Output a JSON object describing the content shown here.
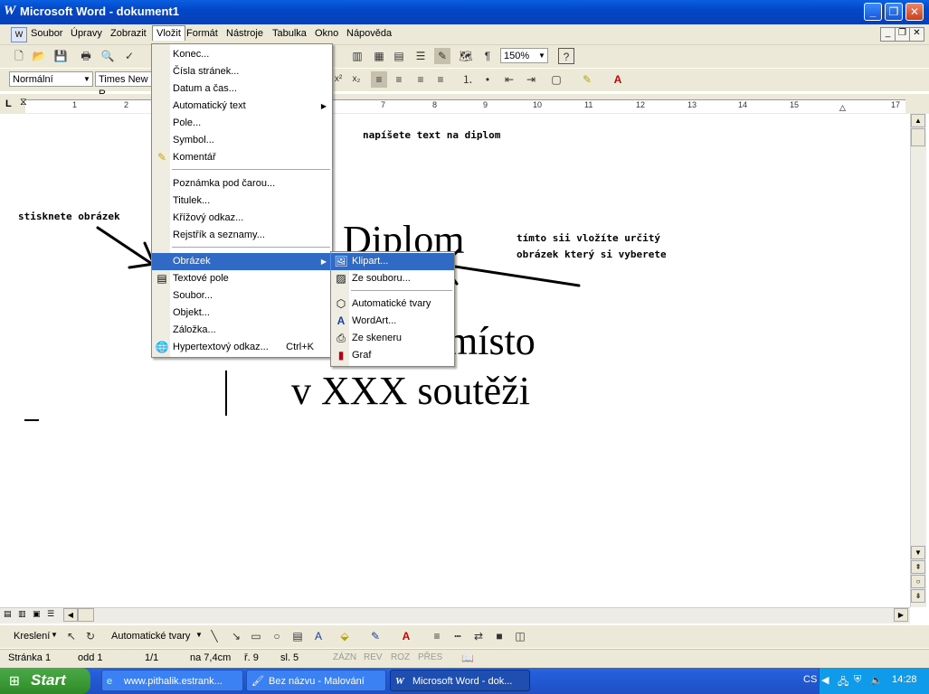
{
  "window": {
    "title": "Microsoft Word - dokument1"
  },
  "menubar": {
    "items": [
      "Soubor",
      "Úpravy",
      "Zobrazit",
      "Vložit",
      "Formát",
      "Nástroje",
      "Tabulka",
      "Okno",
      "Nápověda"
    ]
  },
  "format_toolbar": {
    "style": "Normální",
    "font": "Times New R",
    "zoom": "150%"
  },
  "ruler": {
    "numbers": [
      "1",
      "2",
      "7",
      "8",
      "9",
      "10",
      "11",
      "12",
      "13",
      "14",
      "15",
      "17"
    ]
  },
  "insert_menu": {
    "items": [
      "Konec...",
      "Čísla stránek...",
      "Datum a čas...",
      "Automatický text",
      "Pole...",
      "Symbol...",
      "Komentář",
      "Poznámka pod čarou...",
      "Titulek...",
      "Křížový odkaz...",
      "Rejstřík a seznamy...",
      "Obrázek",
      "Textové pole",
      "Soubor...",
      "Objekt...",
      "Záložka...",
      "Hypertextový odkaz..."
    ],
    "shortcut_hyperlink": "Ctrl+K"
  },
  "picture_submenu": {
    "items": [
      "Klipart...",
      "Ze souboru...",
      "Automatické tvary",
      "WordArt...",
      "Ze skeneru",
      "Graf"
    ]
  },
  "document": {
    "note_top": "napíšete text na diplom",
    "note_left": "stisknete obrázek",
    "note_right_1": "tímto sii vložíte určitý",
    "note_right_2": "obrázek který si vyberete",
    "heading": "Diplom",
    "line2": "místo",
    "line3": "v XXX soutěži"
  },
  "drawing_toolbar": {
    "draw_label": "Kreslení",
    "autoshapes_label": "Automatické tvary"
  },
  "statusbar": {
    "page": "Stránka 1",
    "section": "odd 1",
    "pages": "1/1",
    "position": "na 7,4cm",
    "line": "ř. 9",
    "col": "sl. 5",
    "rec": "ZÁZN",
    "trk": "REV",
    "ext": "ROZ",
    "ovr": "PŘES"
  },
  "taskbar": {
    "start": "Start",
    "tasks": [
      "www.pithalik.estrank...",
      "Bez názvu - Malování",
      "Microsoft Word - dok..."
    ],
    "lang": "CS",
    "clock": "14:28"
  },
  "colors": {
    "titlebar": "#0a5fe0",
    "highlight": "#316ac5",
    "taskbar": "#245edb",
    "start": "#3c9b36"
  }
}
